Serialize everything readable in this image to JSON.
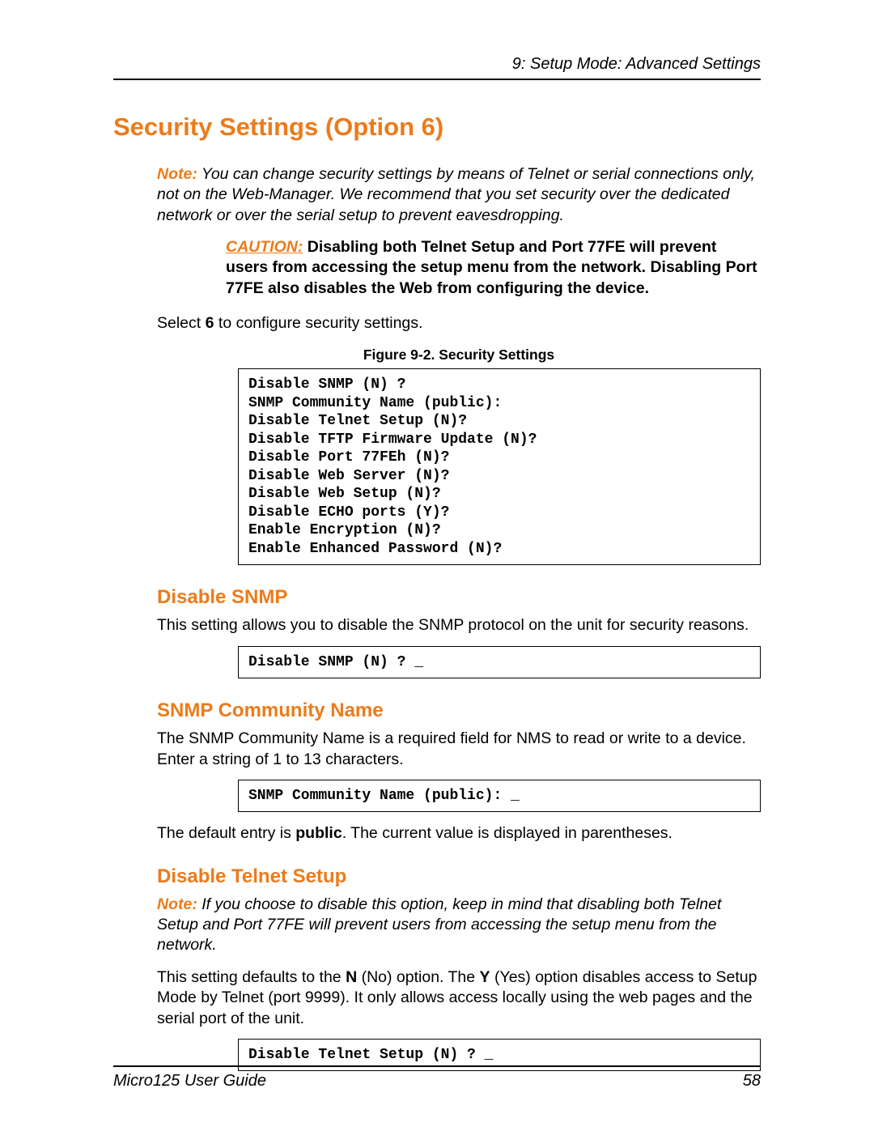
{
  "header": {
    "chapter": "9: Setup Mode: Advanced Settings"
  },
  "main": {
    "h1": "Security Settings (Option 6)",
    "note1_label": "Note:",
    "note1_body": " You can change security settings by means of Telnet or serial connections only, not on the Web-Manager. We recommend that you set security over the dedicated network or over the serial setup to prevent eavesdropping.",
    "caution_label": "CAUTION:",
    "caution_body": " Disabling both Telnet Setup and Port 77FE will prevent users from accessing the setup menu from the network. Disabling Port 77FE also disables the Web from configuring the device.",
    "select_prefix": "Select ",
    "select_bold": "6",
    "select_suffix": " to configure security settings.",
    "figure_caption": "Figure 9-2. Security Settings",
    "code_block_main": "Disable SNMP (N) ?\nSNMP Community Name (public):\nDisable Telnet Setup (N)?\nDisable TFTP Firmware Update (N)?\nDisable Port 77FEh (N)?\nDisable Web Server (N)?\nDisable Web Setup (N)?\nDisable ECHO ports (Y)?\nEnable Encryption (N)?\nEnable Enhanced Password (N)?",
    "sec1_h2": "Disable SNMP",
    "sec1_body": "This setting allows you to disable the SNMP protocol on the unit for security reasons.",
    "sec1_code": "Disable SNMP (N) ? _",
    "sec2_h2": "SNMP Community Name",
    "sec2_body": "The SNMP Community Name is a required field for NMS to read or write to a device. Enter a string of 1 to 13 characters.",
    "sec2_code": "SNMP Community Name (public): _",
    "sec2_after_prefix": "The default entry is ",
    "sec2_after_bold": "public",
    "sec2_after_suffix": ". The current value is displayed in parentheses.",
    "sec3_h2": "Disable Telnet Setup",
    "sec3_note_label": "Note:",
    "sec3_note_body": " If you choose to disable this option, keep in mind that disabling both Telnet Setup and Port 77FE will prevent users from accessing the setup menu from the network.",
    "sec3_body_prefix": "This setting defaults to the ",
    "sec3_body_bold1": "N",
    "sec3_body_mid1": " (No) option. The ",
    "sec3_body_bold2": "Y",
    "sec3_body_suffix": " (Yes) option disables access to Setup Mode by Telnet (port 9999). It only allows access locally using the web pages and the serial port of the unit.",
    "sec3_code": "Disable Telnet Setup (N) ? _"
  },
  "footer": {
    "guide": "Micro125 User Guide",
    "page": "58"
  }
}
